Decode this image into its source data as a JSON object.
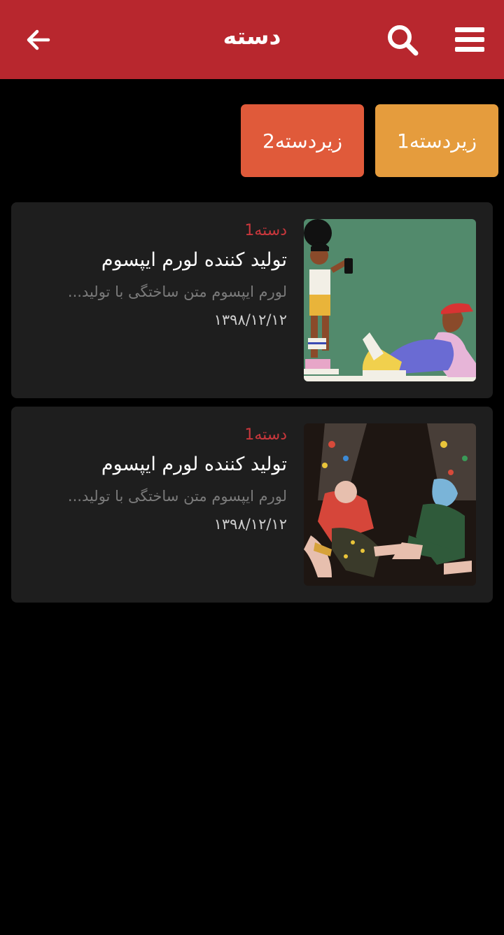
{
  "header": {
    "title": "دسته",
    "icons": [
      "back-arrow-icon",
      "search-icon",
      "hamburger-menu-icon"
    ]
  },
  "subcategories": [
    {
      "label": "زیردسته1",
      "color": "#e59c3d"
    },
    {
      "label": "زیردسته2",
      "color": "#e05a3a"
    }
  ],
  "posts": [
    {
      "category": "دسته1",
      "title": "تولید کننده لورم ایپسوم",
      "excerpt": "لورم ایپسوم متن ساختگی با تولید...",
      "date": "۱۳۹۸/۱۲/۱۲"
    },
    {
      "category": "دسته1",
      "title": "تولید کننده لورم ایپسوم",
      "excerpt": "لورم ایپسوم متن ساختگی با تولید...",
      "date": "۱۳۹۸/۱۲/۱۲"
    }
  ],
  "colors": {
    "appbar": "#b8272e",
    "accent": "#c8373c",
    "card": "#1e1e1e",
    "background": "#000000"
  }
}
